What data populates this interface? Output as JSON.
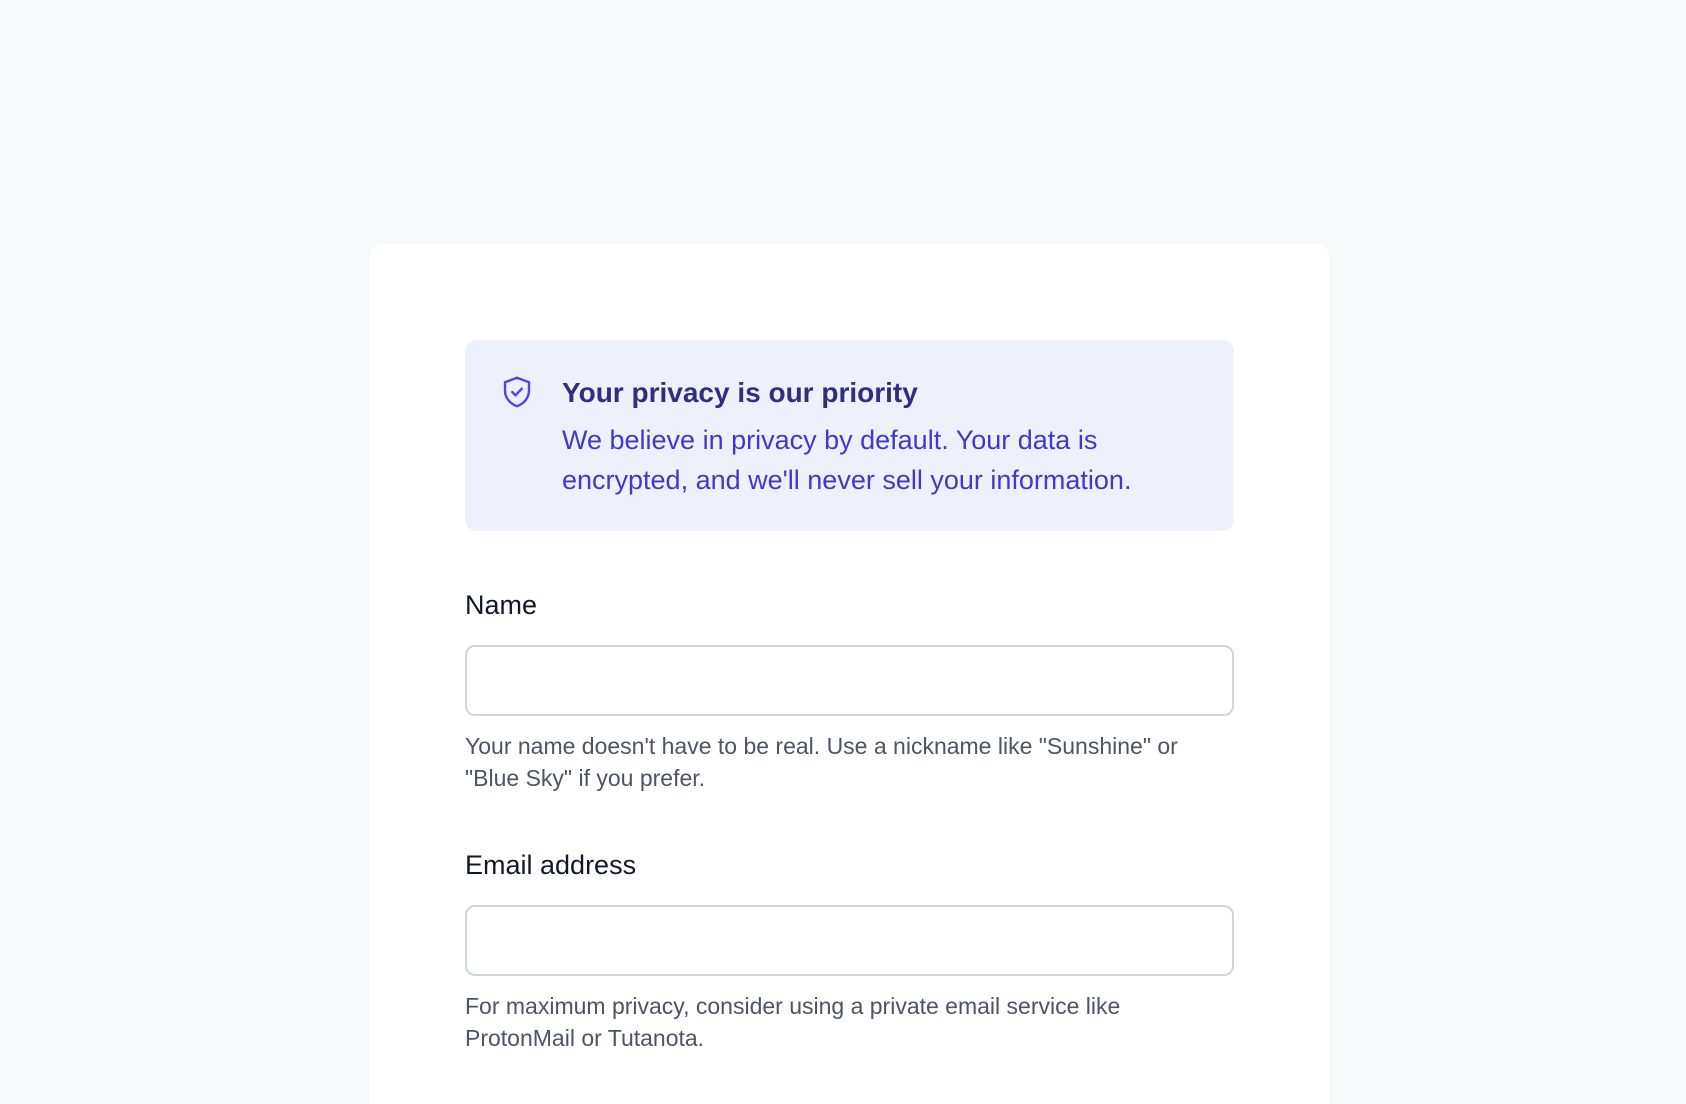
{
  "notice": {
    "icon": "shield-check-icon",
    "title": "Your privacy is our priority",
    "body": "We believe in privacy by default. Your data is encrypted, and we'll never sell your information."
  },
  "form": {
    "name": {
      "label": "Name",
      "value": "",
      "help": "Your name doesn't have to be real. Use a nickname like \"Sunshine\" or \"Blue Sky\" if you prefer."
    },
    "email": {
      "label": "Email address",
      "value": "",
      "help": "For maximum privacy, consider using a private email service like ProtonMail or Tutanota."
    }
  },
  "colors": {
    "background": "#f8f9fb",
    "card": "#ffffff",
    "notice_bg": "#eef0fc",
    "notice_title": "#312e81",
    "notice_text": "#4338ca",
    "label": "#111827",
    "help": "#4b5563",
    "input_border": "#d1d5db"
  }
}
